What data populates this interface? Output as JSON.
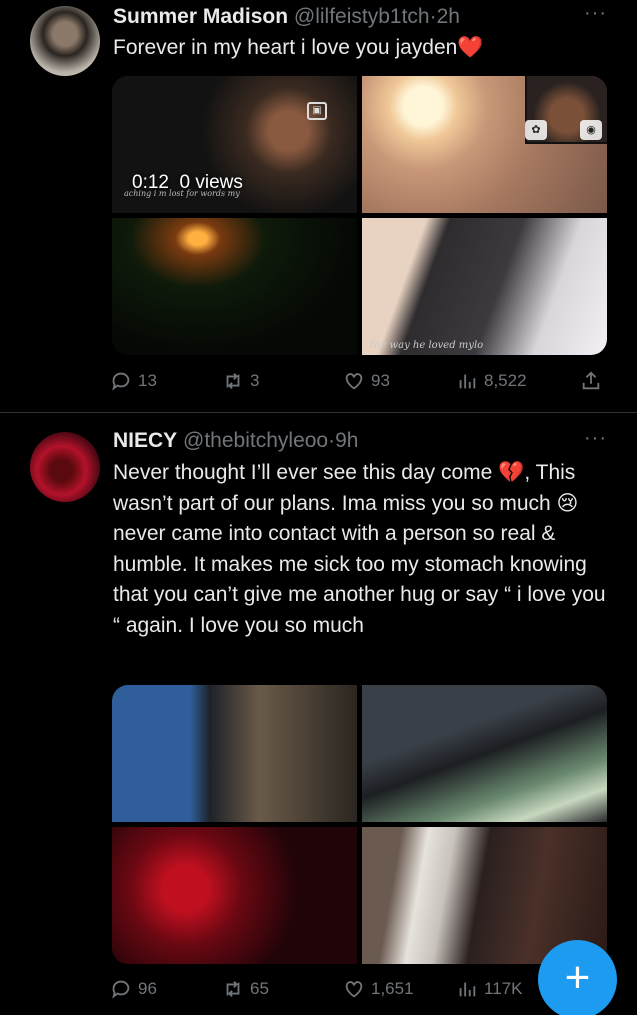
{
  "tweets": [
    {
      "name": "Summer Madison",
      "handle": "@lilfeistyb1tch",
      "time": "2h",
      "more": "···",
      "text": "Forever in my heart i love you jayden❤️",
      "media": {
        "video_time": "0:12",
        "video_views": "0 views",
        "caption_1": "aching i m lost for words my",
        "caption_2": "the way he loved mylo"
      },
      "stats": {
        "replies": "13",
        "reposts": "3",
        "likes": "93",
        "views": "8,522"
      }
    },
    {
      "name": "NIECY",
      "handle": "@thebitchyleoo",
      "time": "9h",
      "more": "···",
      "text": "Never thought I’ll ever see this day come 💔, This wasn’t part of our plans. Ima miss you so much 😢 never came into contact with a person so real & humble. It makes me sick too my stomach knowing that you can’t give me another hug or say “ i love you “ again. I love you so much",
      "stats": {
        "replies": "96",
        "reposts": "65",
        "likes": "1,651",
        "views": "117K"
      }
    }
  ],
  "fab_label": "+",
  "colors": {
    "accent": "#1d9bf0",
    "muted": "#71767b",
    "text": "#e7e9ea",
    "divider": "#2f3336"
  }
}
